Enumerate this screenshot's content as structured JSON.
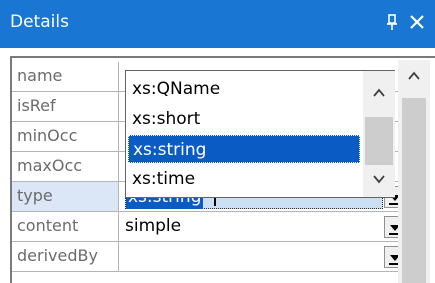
{
  "panel": {
    "title": "Details",
    "pin_glyph": "ᵖ",
    "close_glyph": "✕"
  },
  "rows": [
    {
      "name": "name",
      "value": ""
    },
    {
      "name": "isRef",
      "value": ""
    },
    {
      "name": "minOcc",
      "value": ""
    },
    {
      "name": "maxOcc",
      "value": ""
    },
    {
      "name": "type",
      "value": "xs:string"
    },
    {
      "name": "content",
      "value": "simple"
    },
    {
      "name": "derivedBy",
      "value": ""
    }
  ],
  "dropdown": {
    "items": [
      "xs:QName",
      "xs:short",
      "xs:string",
      "xs:time"
    ],
    "selected_index": 2
  },
  "colors": {
    "titlebar": "#1976d2",
    "selection": "#0a5bc4",
    "selected_row_bg": "#dbe7f7"
  }
}
